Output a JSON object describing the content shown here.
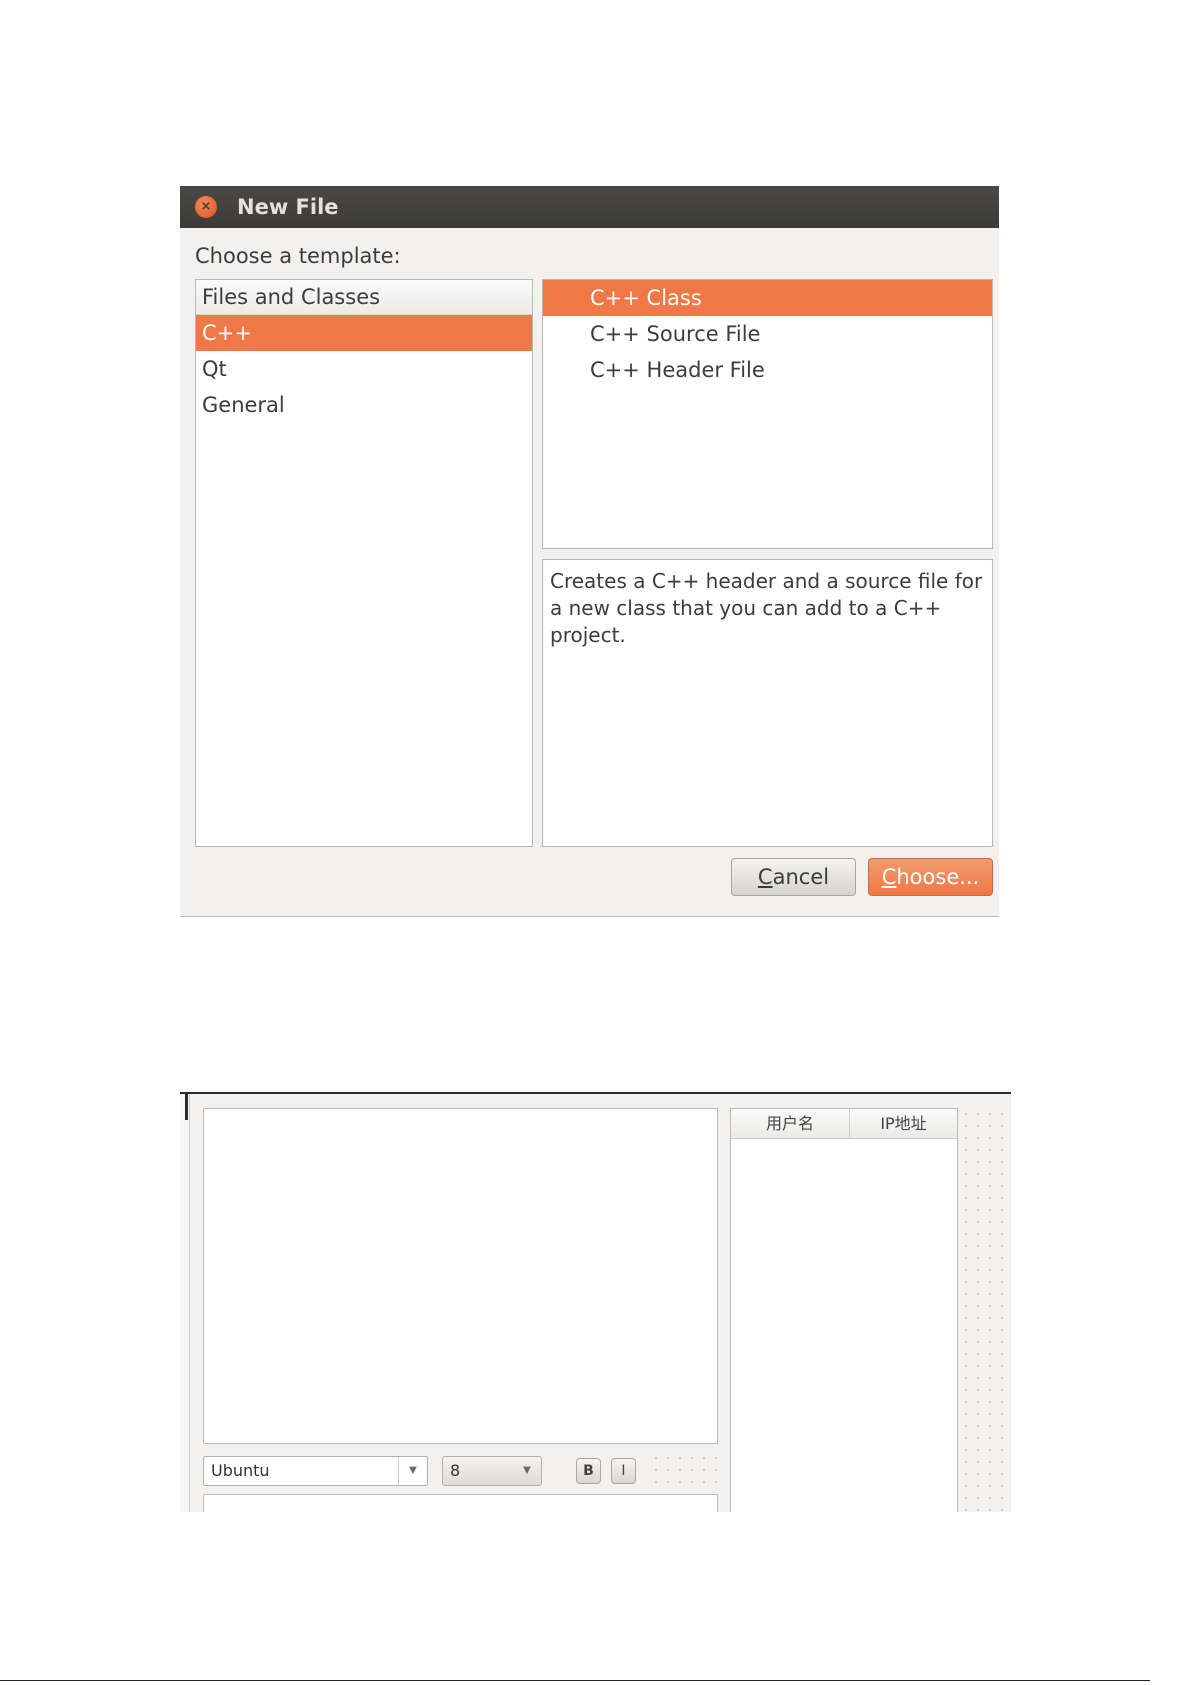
{
  "dialog": {
    "title": "New File",
    "close_icon": "close-icon",
    "prompt": "Choose a template:",
    "categories_header": "Files and Classes",
    "categories": [
      {
        "label": "C++",
        "selected": true
      },
      {
        "label": "Qt",
        "selected": false
      },
      {
        "label": "General",
        "selected": false
      }
    ],
    "templates": [
      {
        "label": "C++ Class",
        "selected": true
      },
      {
        "label": "C++ Source File",
        "selected": false
      },
      {
        "label": "C++ Header File",
        "selected": false
      }
    ],
    "description": "Creates a C++ header and a source file for a new class that you can add to a C++ project.",
    "cancel_button": {
      "mnemonic": "C",
      "rest": "ancel"
    },
    "choose_button": {
      "mnemonic": "C",
      "rest": "hoose..."
    },
    "colors": {
      "accent": "#f07746",
      "titlebar": "#3c3b37",
      "background": "#f2f1f0"
    }
  },
  "chat": {
    "font_combo": "Ubuntu",
    "size_combo": "8",
    "bold_label": "B",
    "italic_label": "I",
    "user_table": {
      "columns": [
        "用户名",
        "IP地址"
      ]
    },
    "icons": {
      "dropdown": "chevron-down-icon"
    }
  }
}
